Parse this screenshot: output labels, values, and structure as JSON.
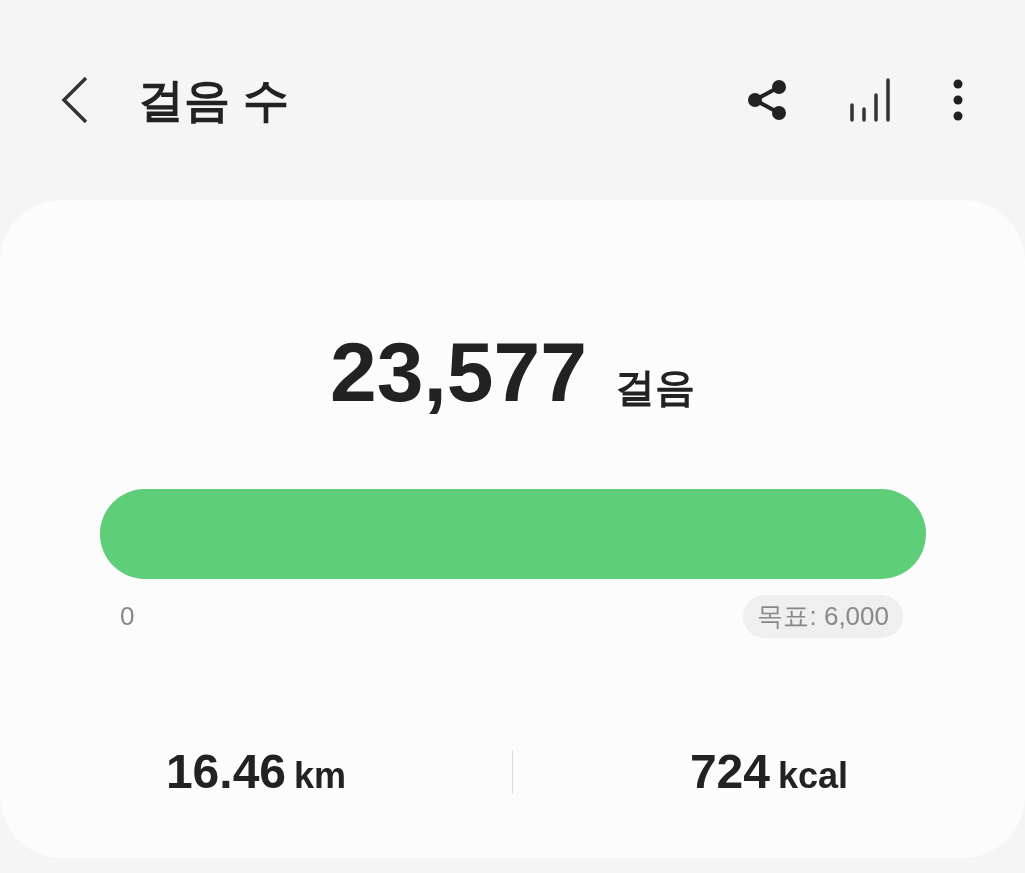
{
  "header": {
    "title": "걸음 수"
  },
  "summary": {
    "count": "23,577",
    "unit": "걸음"
  },
  "progress": {
    "level": 1,
    "min_label": "0",
    "goal_label": "목표: 6,000"
  },
  "stats": [
    {
      "value": "16.46",
      "unit": "km"
    },
    {
      "value": "724",
      "unit": "kcal"
    }
  ]
}
